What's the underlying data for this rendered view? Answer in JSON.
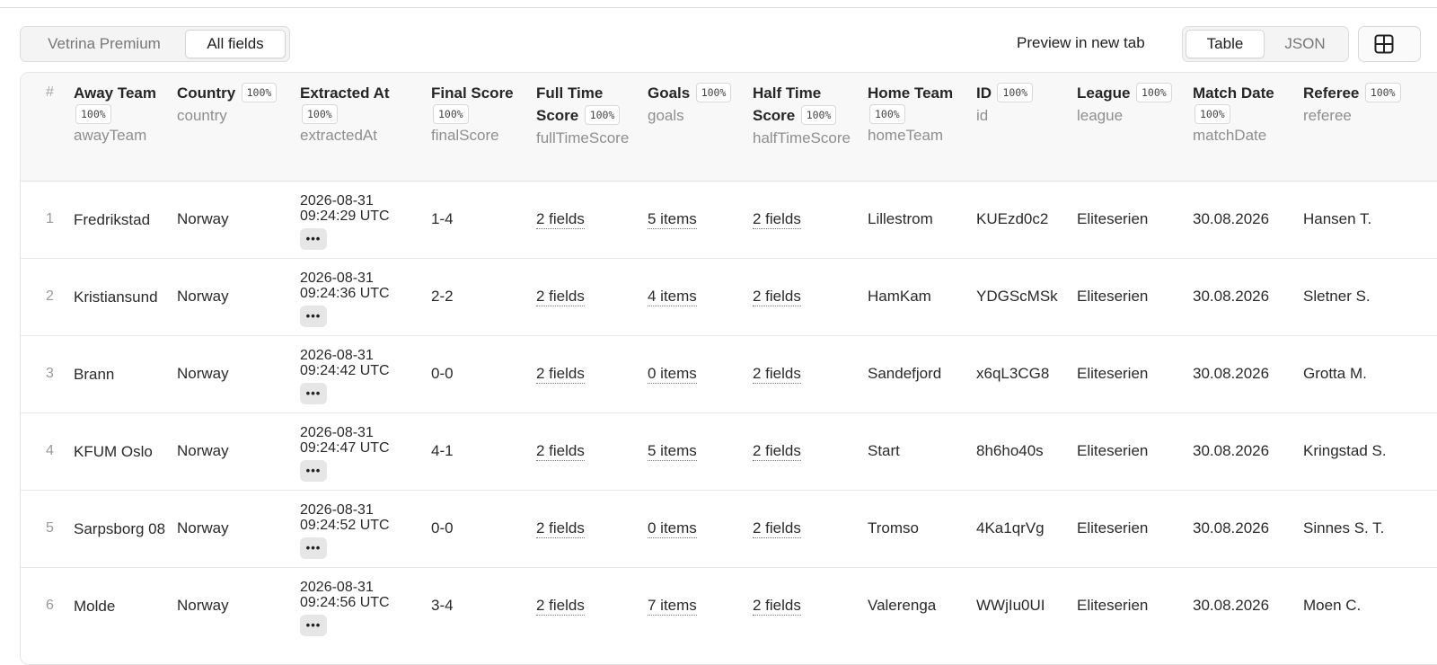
{
  "toolbar": {
    "dataset_tabs": [
      "Vetrina Premium",
      "All fields"
    ],
    "preview_label": "Preview in new tab",
    "view_tabs": [
      "Table",
      "JSON"
    ],
    "layout_icon": "layout-grid-icon"
  },
  "table": {
    "index_header": "#",
    "columns": [
      {
        "label": "Away Team",
        "badge": "100%",
        "key": "awayTeam"
      },
      {
        "label": "Country",
        "badge": "100%",
        "key": "country"
      },
      {
        "label": "Extracted At",
        "badge": "100%",
        "key": "extractedAt"
      },
      {
        "label": "Final Score",
        "badge": "100%",
        "key": "finalScore"
      },
      {
        "label": "Full Time Score",
        "badge": "100%",
        "key": "fullTimeScore"
      },
      {
        "label": "Goals",
        "badge": "100%",
        "key": "goals"
      },
      {
        "label": "Half Time Score",
        "badge": "100%",
        "key": "halfTimeScore"
      },
      {
        "label": "Home Team",
        "badge": "100%",
        "key": "homeTeam"
      },
      {
        "label": "ID",
        "badge": "100%",
        "key": "id"
      },
      {
        "label": "League",
        "badge": "100%",
        "key": "league"
      },
      {
        "label": "Match Date",
        "badge": "100%",
        "key": "matchDate"
      },
      {
        "label": "Referee",
        "badge": "100%",
        "key": "referee"
      }
    ],
    "rows": [
      {
        "index": "1",
        "awayTeam": "Fredrikstad",
        "country": "Norway",
        "extractedDate": "2026-08-31",
        "extractedTime": "09:24:29 UTC",
        "finalScore": "1-4",
        "fullTimeScore": "2 fields",
        "goals": "5 items",
        "halfTimeScore": "2 fields",
        "homeTeam": "Lillestrom",
        "id": "KUEzd0c2",
        "league": "Eliteserien",
        "matchDate": "30.08.2026",
        "referee": "Hansen T."
      },
      {
        "index": "2",
        "awayTeam": "Kristiansund",
        "country": "Norway",
        "extractedDate": "2026-08-31",
        "extractedTime": "09:24:36 UTC",
        "finalScore": "2-2",
        "fullTimeScore": "2 fields",
        "goals": "4 items",
        "halfTimeScore": "2 fields",
        "homeTeam": "HamKam",
        "id": "YDGScMSk",
        "league": "Eliteserien",
        "matchDate": "30.08.2026",
        "referee": "Sletner S."
      },
      {
        "index": "3",
        "awayTeam": "Brann",
        "country": "Norway",
        "extractedDate": "2026-08-31",
        "extractedTime": "09:24:42 UTC",
        "finalScore": "0-0",
        "fullTimeScore": "2 fields",
        "goals": "0 items",
        "halfTimeScore": "2 fields",
        "homeTeam": "Sandefjord",
        "id": "x6qL3CG8",
        "league": "Eliteserien",
        "matchDate": "30.08.2026",
        "referee": "Grotta M."
      },
      {
        "index": "4",
        "awayTeam": "KFUM Oslo",
        "country": "Norway",
        "extractedDate": "2026-08-31",
        "extractedTime": "09:24:47 UTC",
        "finalScore": "4-1",
        "fullTimeScore": "2 fields",
        "goals": "5 items",
        "halfTimeScore": "2 fields",
        "homeTeam": "Start",
        "id": "8h6ho40s",
        "league": "Eliteserien",
        "matchDate": "30.08.2026",
        "referee": "Kringstad S."
      },
      {
        "index": "5",
        "awayTeam": "Sarpsborg 08",
        "country": "Norway",
        "extractedDate": "2026-08-31",
        "extractedTime": "09:24:52 UTC",
        "finalScore": "0-0",
        "fullTimeScore": "2 fields",
        "goals": "0 items",
        "halfTimeScore": "2 fields",
        "homeTeam": "Tromso",
        "id": "4Ka1qrVg",
        "league": "Eliteserien",
        "matchDate": "30.08.2026",
        "referee": "Sinnes S. T."
      },
      {
        "index": "6",
        "awayTeam": "Molde",
        "country": "Norway",
        "extractedDate": "2026-08-31",
        "extractedTime": "09:24:56 UTC",
        "finalScore": "3-4",
        "fullTimeScore": "2 fields",
        "goals": "7 items",
        "halfTimeScore": "2 fields",
        "homeTeam": "Valerenga",
        "id": "WWjIu0UI",
        "league": "Eliteserien",
        "matchDate": "30.08.2026",
        "referee": "Moen C."
      }
    ],
    "more_glyph": "•••"
  }
}
